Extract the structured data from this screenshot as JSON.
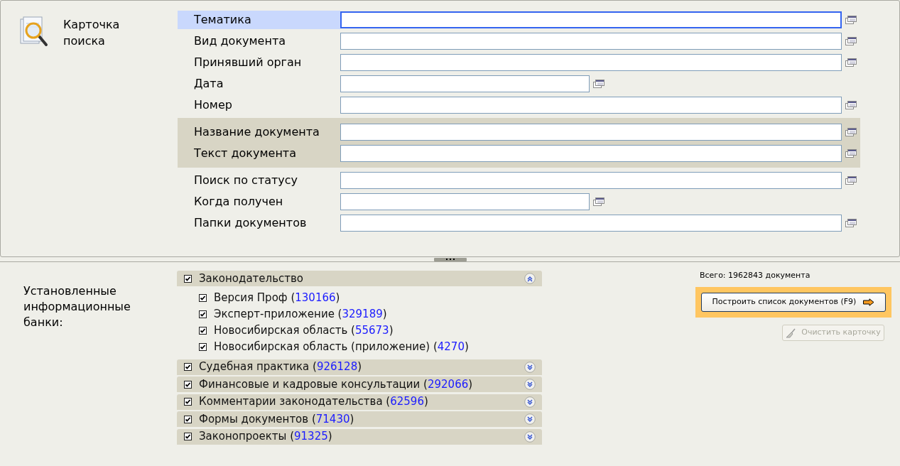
{
  "card": {
    "title": "Карточка поиска"
  },
  "fields": [
    {
      "label": "Тематика",
      "selected": true,
      "kind": "attribute",
      "short": false
    },
    {
      "label": "Вид документа",
      "selected": false,
      "kind": "attribute",
      "short": false
    },
    {
      "label": "Принявший орган",
      "selected": false,
      "kind": "attribute",
      "short": false
    },
    {
      "label": "Дата",
      "selected": false,
      "kind": "attribute",
      "short": true
    },
    {
      "label": "Номер",
      "selected": false,
      "kind": "attribute",
      "short": false
    },
    {
      "label": "Название документа",
      "selected": false,
      "kind": "fulltext",
      "short": false
    },
    {
      "label": "Текст документа",
      "selected": false,
      "kind": "fulltext",
      "short": false
    },
    {
      "label": "Поиск по статусу",
      "selected": false,
      "kind": "attribute",
      "short": false
    },
    {
      "label": "Когда получен",
      "selected": false,
      "kind": "attribute",
      "short": true
    },
    {
      "label": "Папки документов",
      "selected": false,
      "kind": "attribute",
      "short": false
    }
  ],
  "banks": {
    "title": "Установленные информационные банки:",
    "items": [
      {
        "label": "Законодательство",
        "checked": true,
        "expanded": true,
        "children": [
          {
            "label": "Версия Проф",
            "count": "(130166)",
            "checked": true
          },
          {
            "label": "Эксперт-приложение",
            "count": "(329189)",
            "checked": true
          },
          {
            "label": "Новосибирская область",
            "count": "(55673)",
            "checked": true
          },
          {
            "label": "Новосибирская область (приложение)",
            "count": "(4270)",
            "checked": true
          }
        ]
      },
      {
        "label": "Судебная практика",
        "count": "(926128)",
        "checked": true,
        "expanded": false
      },
      {
        "label": "Финансовые и кадровые консультации",
        "count": "(292066)",
        "checked": true,
        "expanded": false
      },
      {
        "label": "Комментарии законодательства",
        "count": "(62596)",
        "checked": true,
        "expanded": false
      },
      {
        "label": "Формы документов",
        "count": "(71430)",
        "checked": true,
        "expanded": false
      },
      {
        "label": "Законопроекты",
        "count": "(91325)",
        "checked": true,
        "expanded": false
      }
    ]
  },
  "total": "Всего: 1962843 документа",
  "build_button": {
    "label": "Построить список документов (F9)"
  },
  "clear_button": {
    "label": "Очистить карточку",
    "disabled": true
  }
}
